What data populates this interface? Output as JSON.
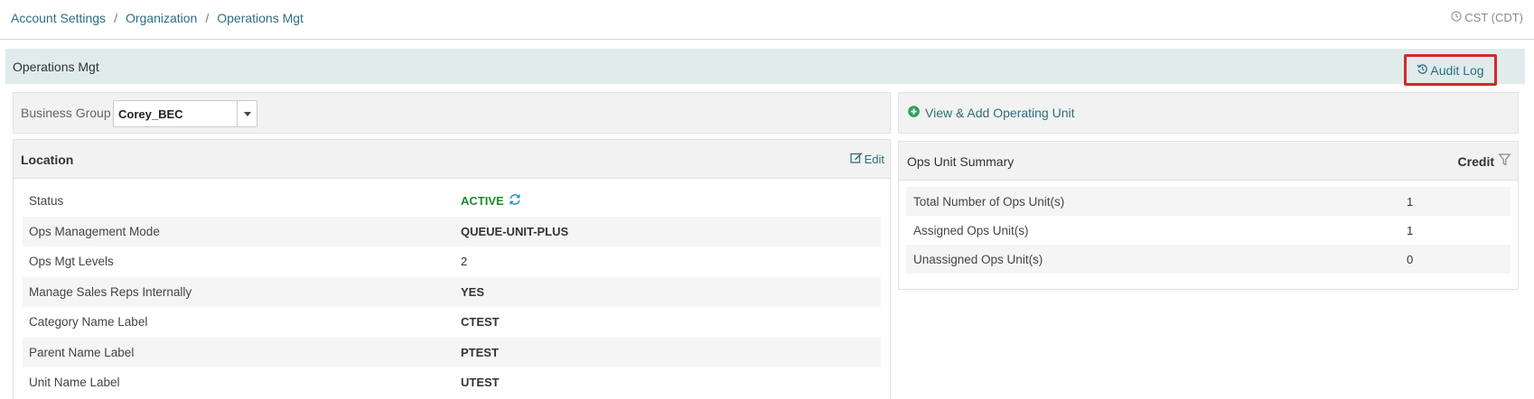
{
  "breadcrumb": {
    "items": [
      "Account Settings",
      "Organization",
      "Operations Mgt"
    ],
    "separator": "/"
  },
  "timezone": "CST (CDT)",
  "panel": {
    "title": "Operations Mgt",
    "audit_log_label": "Audit Log"
  },
  "business_group": {
    "label": "Business Group",
    "selected": "Corey_BEC"
  },
  "location": {
    "title": "Location",
    "edit_label": "Edit",
    "rows": [
      {
        "label": "Status",
        "value": "ACTIVE"
      },
      {
        "label": "Ops Management Mode",
        "value": "QUEUE-UNIT-PLUS"
      },
      {
        "label": "Ops Mgt Levels",
        "value": "2"
      },
      {
        "label": "Manage Sales Reps Internally",
        "value": "YES"
      },
      {
        "label": "Category Name Label",
        "value": "CTEST"
      },
      {
        "label": "Parent Name Label",
        "value": "PTEST"
      },
      {
        "label": "Unit Name Label",
        "value": "UTEST"
      }
    ]
  },
  "ops_unit_link": "View & Add Operating Unit",
  "summary": {
    "title": "Ops Unit Summary",
    "filter_label": "Credit",
    "rows": [
      {
        "label": "Total Number of Ops Unit(s)",
        "value": "1"
      },
      {
        "label": "Assigned Ops Unit(s)",
        "value": "1"
      },
      {
        "label": "Unassigned Ops Unit(s)",
        "value": "0"
      }
    ]
  },
  "colors": {
    "link": "#2e6e82",
    "active_status": "#1f8a2e",
    "header_band": "#dfeceb",
    "highlight_border": "#d9262c",
    "plus_icon": "#2f9e5a",
    "refresh_icon": "#2a8fd6"
  },
  "icons": {
    "timezone": "clock-icon",
    "audit": "history-icon",
    "edit": "edit-icon",
    "refresh": "refresh-icon",
    "add": "plus-circle-icon",
    "filter": "filter-icon",
    "dropdown": "caret-down-icon"
  }
}
